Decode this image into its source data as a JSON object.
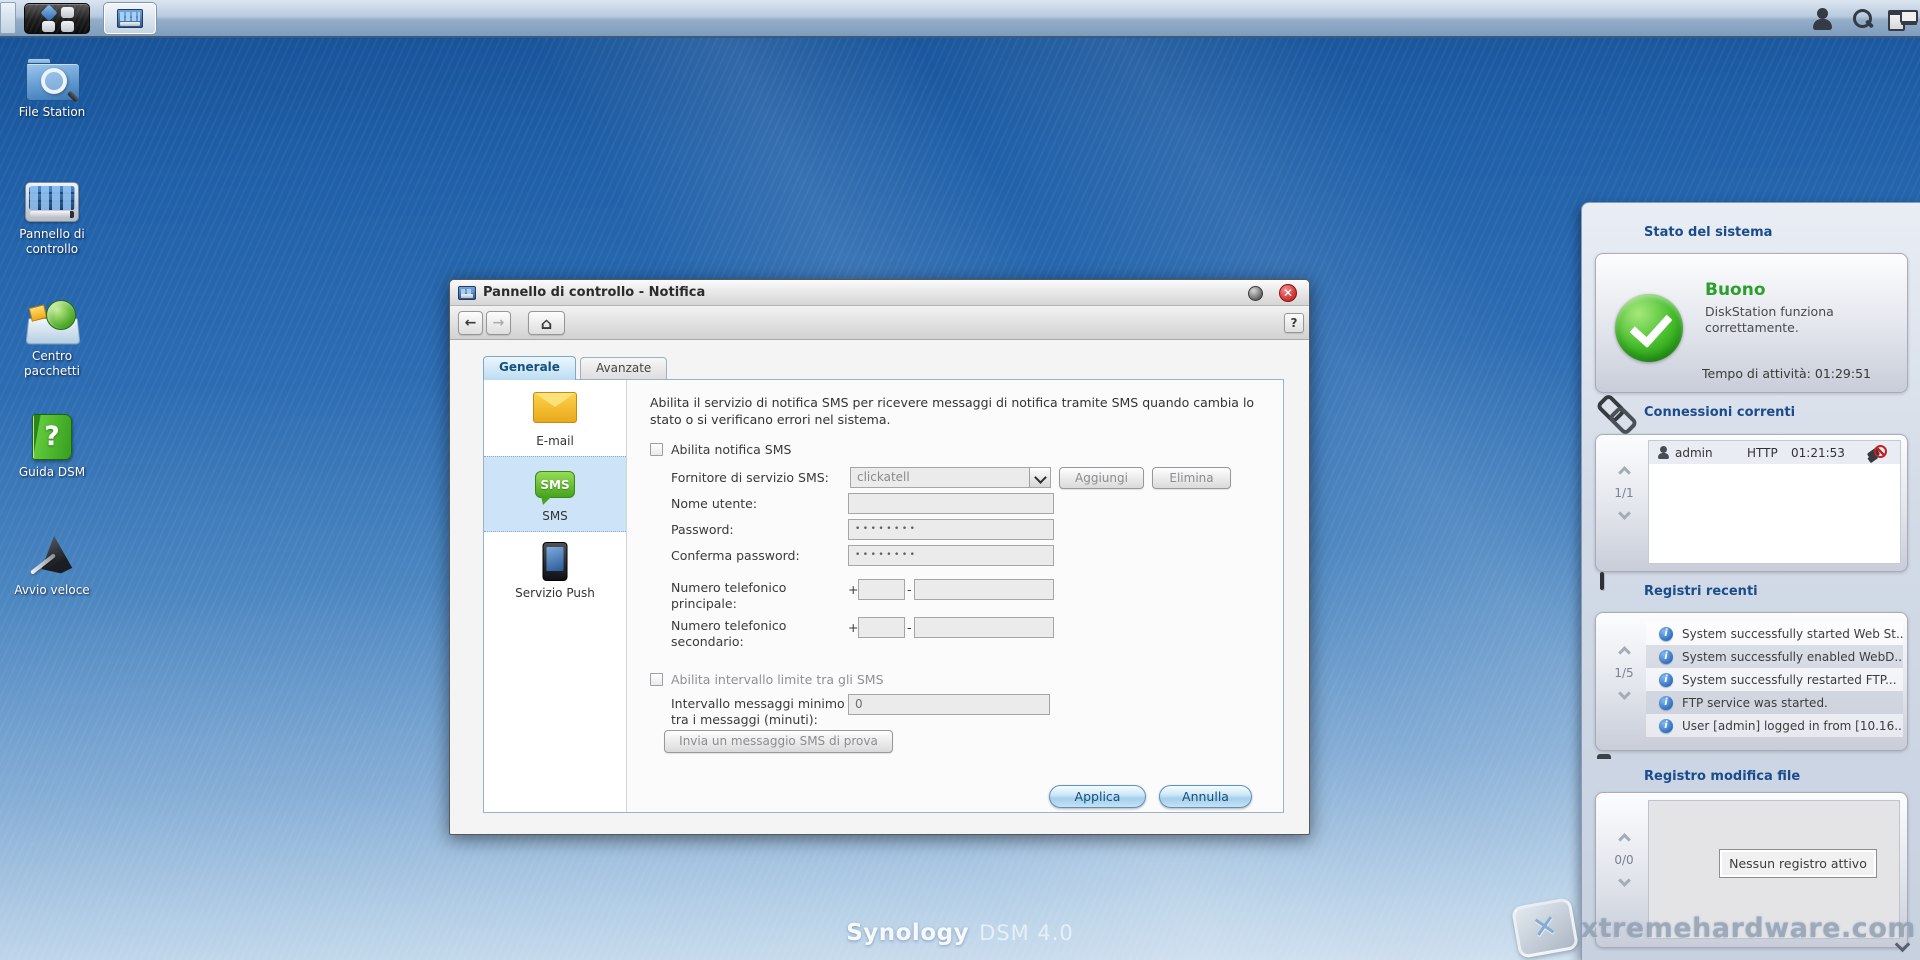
{
  "taskbar": {
    "icons_right": [
      "user",
      "search",
      "pilot-view"
    ]
  },
  "desktop": {
    "icons": [
      {
        "label": "File Station"
      },
      {
        "label": "Pannello di controllo"
      },
      {
        "label": "Centro pacchetti"
      },
      {
        "label": "Guida DSM"
      },
      {
        "label": "Avvio veloce"
      }
    ],
    "branding": {
      "name": "Synology",
      "version": "DSM 4.0"
    },
    "watermark": "xtremehardware.com"
  },
  "window": {
    "title": "Pannello di controllo - Notifica",
    "help_label": "?",
    "tabs": [
      {
        "label": "Generale"
      },
      {
        "label": "Avanzate"
      }
    ],
    "sidebar": [
      {
        "label": "E-mail"
      },
      {
        "label": "SMS",
        "icon_text": "SMS"
      },
      {
        "label": "Servizio Push"
      }
    ],
    "form": {
      "description": "Abilita il servizio di notifica SMS per ricevere messaggi di notifica tramite SMS quando cambia lo stato o si verificano errori nel sistema.",
      "enable_sms_label": "Abilita notifica SMS",
      "provider_label": "Fornitore di servizio SMS:",
      "provider_value": "clickatell",
      "add_button": "Aggiungi",
      "delete_button": "Elimina",
      "username_label": "Nome utente:",
      "password_label": "Password:",
      "password_value": "••••••••",
      "confirm_label": "Conferma password:",
      "confirm_value": "••••••••",
      "phone1_label": "Numero telefonico principale:",
      "phone2_label": "Numero telefonico secondario:",
      "phone_prefix": "+",
      "phone_sep": "-",
      "interval_checkbox_label": "Abilita intervallo limite tra gli SMS",
      "interval_label": "Intervallo messaggi minimo tra i messaggi (minuti):",
      "interval_value": "0",
      "test_button": "Invia un messaggio SMS di prova"
    },
    "apply_button": "Applica",
    "cancel_button": "Annulla"
  },
  "widgets": {
    "system_status": {
      "title": "Stato del sistema",
      "status": "Buono",
      "message": "DiskStation funziona correttamente.",
      "uptime": "Tempo di attività: 01:29:51"
    },
    "connections": {
      "title": "Connessioni correnti",
      "page": "1/1",
      "rows": [
        {
          "user": "admin",
          "protocol": "HTTP",
          "time": "01:21:53"
        }
      ]
    },
    "recent_logs": {
      "title": "Registri recenti",
      "page": "1/5",
      "entries": [
        {
          "text": "System successfully started Web St..."
        },
        {
          "text": "System successfully enabled WebD..."
        },
        {
          "text": "System successfully restarted FTP..."
        },
        {
          "text": "FTP service was started."
        },
        {
          "text": "User [admin] logged in from [10.16..."
        }
      ]
    },
    "file_log": {
      "title": "Registro modifica file",
      "page": "0/0",
      "empty_message": "Nessun registro attivo"
    }
  },
  "colors": {
    "accent_blue": "#15507e",
    "status_green": "#2aa02a",
    "header_blue": "#1a4c8c"
  }
}
